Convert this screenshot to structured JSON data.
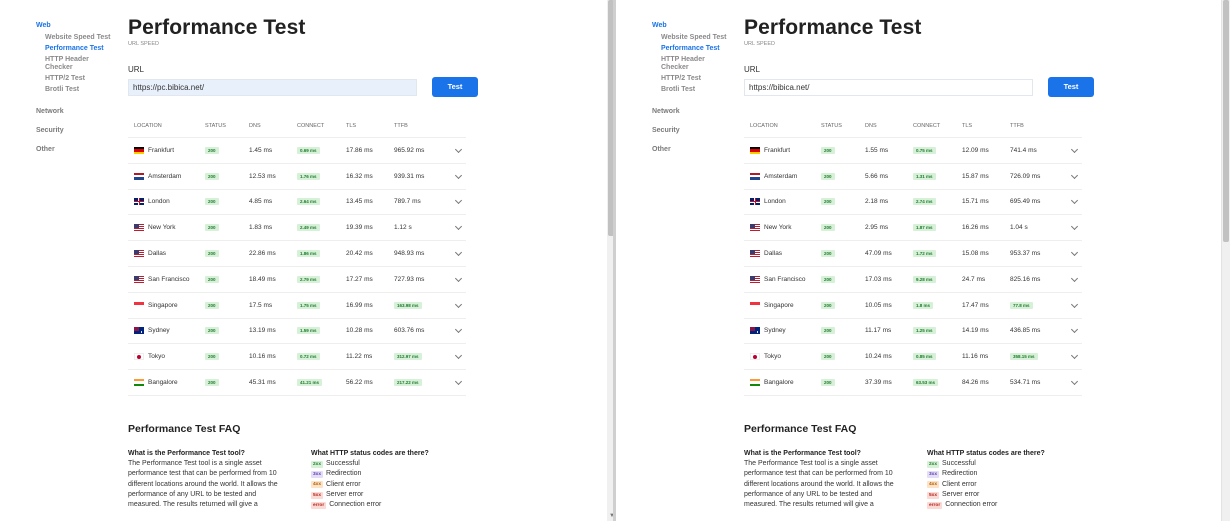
{
  "sidebar": {
    "categories": [
      "Web",
      "Network",
      "Security",
      "Other"
    ],
    "web_items": [
      "Website Speed Test",
      "Performance Test",
      "HTTP Header Checker",
      "HTTP/2 Test",
      "Brotli Test"
    ]
  },
  "main": {
    "title": "Performance Test",
    "subtitle": "URL SPEED",
    "url_label": "URL",
    "test_button": "Test"
  },
  "table": {
    "headers": [
      "LOCATION",
      "STATUS",
      "DNS",
      "CONNECT",
      "TLS",
      "TTFB"
    ]
  },
  "locations": [
    "Frankfurt",
    "Amsterdam",
    "London",
    "New York",
    "Dallas",
    "San Francisco",
    "Singapore",
    "Sydney",
    "Tokyo",
    "Bangalore"
  ],
  "panes": [
    {
      "url": "https://pc.bibica.net/",
      "rows": [
        {
          "status": "200",
          "dns": "1.45 ms",
          "connect": "0.69 ms",
          "tls": "17.86 ms",
          "ttfb": "965.92 ms"
        },
        {
          "status": "200",
          "dns": "12.53 ms",
          "connect": "1.76 ms",
          "tls": "16.32 ms",
          "ttfb": "939.31 ms"
        },
        {
          "status": "200",
          "dns": "4.85 ms",
          "connect": "2.64 ms",
          "tls": "13.45 ms",
          "ttfb": "789.7 ms"
        },
        {
          "status": "200",
          "dns": "1.83 ms",
          "connect": "2.49 ms",
          "tls": "19.39 ms",
          "ttfb": "1.12 s"
        },
        {
          "status": "200",
          "dns": "22.86 ms",
          "connect": "1.86 ms",
          "tls": "20.42 ms",
          "ttfb": "948.93 ms"
        },
        {
          "status": "200",
          "dns": "18.49 ms",
          "connect": "2.79 ms",
          "tls": "17.27 ms",
          "ttfb": "727.93 ms"
        },
        {
          "status": "200",
          "dns": "17.5 ms",
          "connect": "1.75 ms",
          "tls": "16.99 ms",
          "ttfb": "163.98 ms"
        },
        {
          "status": "200",
          "dns": "13.19 ms",
          "connect": "1.59 ms",
          "tls": "10.28 ms",
          "ttfb": "603.76 ms"
        },
        {
          "status": "200",
          "dns": "10.16 ms",
          "connect": "0.72 ms",
          "tls": "11.22 ms",
          "ttfb": "312.97 ms"
        },
        {
          "status": "200",
          "dns": "45.31 ms",
          "connect": "41.21 ms",
          "tls": "56.22 ms",
          "ttfb": "217.22 ms"
        }
      ]
    },
    {
      "url": "https://bibica.net/",
      "rows": [
        {
          "status": "200",
          "dns": "1.55 ms",
          "connect": "0.75 ms",
          "tls": "12.09 ms",
          "ttfb": "741.4 ms"
        },
        {
          "status": "200",
          "dns": "5.66 ms",
          "connect": "1.31 ms",
          "tls": "15.87 ms",
          "ttfb": "726.09 ms"
        },
        {
          "status": "200",
          "dns": "2.18 ms",
          "connect": "2.74 ms",
          "tls": "15.71 ms",
          "ttfb": "695.49 ms"
        },
        {
          "status": "200",
          "dns": "2.95 ms",
          "connect": "1.87 ms",
          "tls": "16.26 ms",
          "ttfb": "1.04 s"
        },
        {
          "status": "200",
          "dns": "47.09 ms",
          "connect": "1.72 ms",
          "tls": "15.08 ms",
          "ttfb": "953.37 ms"
        },
        {
          "status": "200",
          "dns": "17.03 ms",
          "connect": "9.28 ms",
          "tls": "24.7 ms",
          "ttfb": "825.16 ms"
        },
        {
          "status": "200",
          "dns": "10.05 ms",
          "connect": "1.8 ms",
          "tls": "17.47 ms",
          "ttfb": "77.8 ms"
        },
        {
          "status": "200",
          "dns": "11.17 ms",
          "connect": "1.25 ms",
          "tls": "14.19 ms",
          "ttfb": "436.85 ms"
        },
        {
          "status": "200",
          "dns": "10.24 ms",
          "connect": "0.85 ms",
          "tls": "11.16 ms",
          "ttfb": "358.15 ms"
        },
        {
          "status": "200",
          "dns": "37.39 ms",
          "connect": "63.53 ms",
          "tls": "84.26 ms",
          "ttfb": "534.71 ms"
        }
      ]
    }
  ],
  "faq": {
    "title": "Performance Test FAQ",
    "q1": "What is the Performance Test tool?",
    "a1_lines": [
      "The Performance Test tool is a single asset",
      "performance test that can be performed from 10",
      "different locations around the world. It allows the",
      "performance of any URL to be tested and",
      "measured. The results returned will give a"
    ],
    "q2": "What HTTP status codes are there?",
    "codes": [
      {
        "code": "2xx",
        "label": "Successful",
        "bg": "#d6f1d8",
        "fg": "#1f7a2c"
      },
      {
        "code": "3xx",
        "label": "Redirection",
        "bg": "#e4ddf7",
        "fg": "#5a3fb0"
      },
      {
        "code": "4xx",
        "label": "Client error",
        "bg": "#fde3c6",
        "fg": "#b05a00"
      },
      {
        "code": "5xx",
        "label": "Server error",
        "bg": "#fbd9d5",
        "fg": "#b3261e"
      },
      {
        "code": "error",
        "label": "Connection error",
        "bg": "#fbd9d5",
        "fg": "#b3261e"
      }
    ]
  },
  "colors": {
    "accent": "#1a73e8",
    "badge_bg": "#d6f1d8",
    "badge_fg": "#1f7a2c"
  },
  "flags": [
    "de-flag-icon",
    "nl-flag-icon",
    "gb-flag-icon",
    "us-flag-icon",
    "us-flag-icon",
    "us-flag-icon",
    "sg-flag-icon",
    "au-flag-icon",
    "jp-flag-icon",
    "in-flag-icon"
  ]
}
